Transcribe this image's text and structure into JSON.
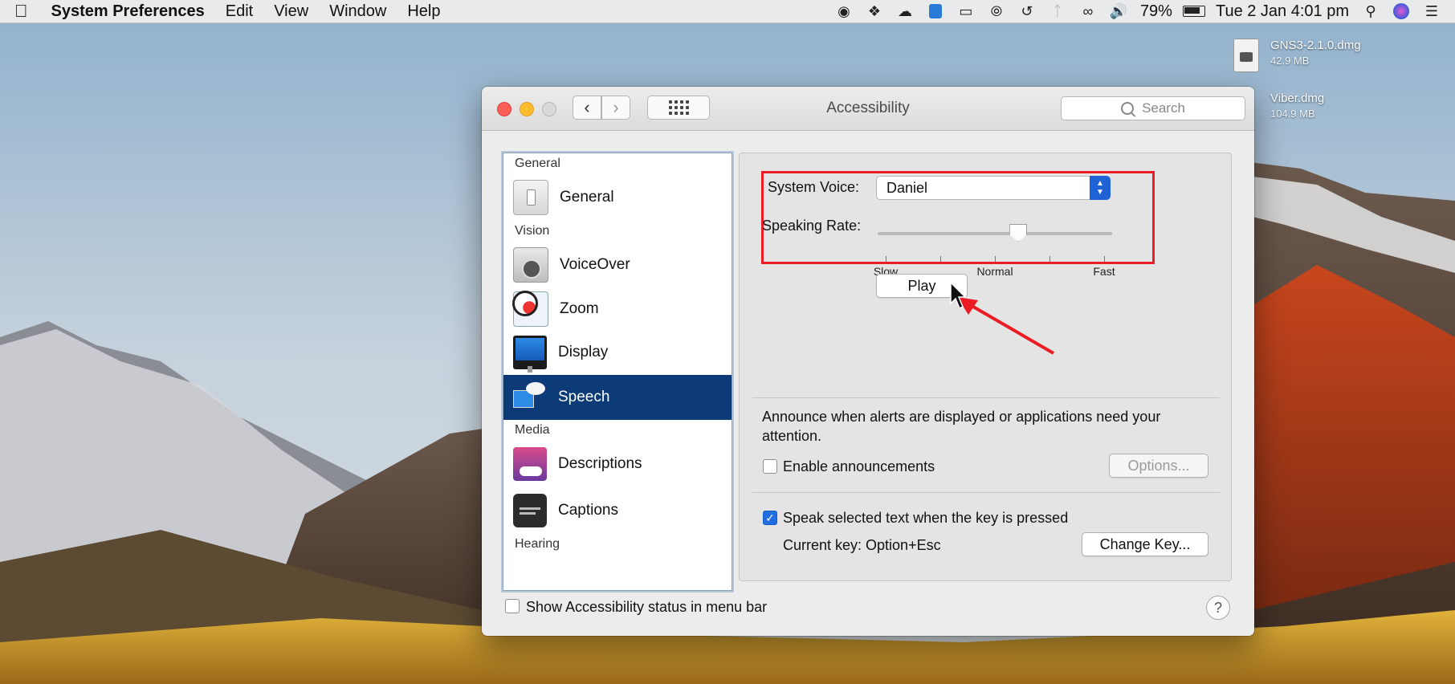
{
  "menubar": {
    "app_name": "System Preferences",
    "menus": [
      "Edit",
      "View",
      "Window",
      "Help"
    ],
    "battery": "79%",
    "clock": "Tue 2 Jan  4:01 pm",
    "status_icons": [
      "record-icon",
      "dropbox-icon",
      "cloud-upload-icon",
      "teamviewer-icon",
      "airplay-icon",
      "wifi-signal-icon",
      "time-machine-icon",
      "bluetooth-icon",
      "sync-icon",
      "volume-icon",
      "battery-icon",
      "spotlight-icon",
      "siri-icon",
      "notification-center-icon"
    ]
  },
  "desktop": {
    "files": [
      {
        "name": "GNS3-2.1.0.dmg",
        "size": "42.9 MB"
      },
      {
        "name": "Viber.dmg",
        "size": "104.9 MB"
      }
    ]
  },
  "window": {
    "title": "Accessibility",
    "search_placeholder": "Search"
  },
  "sidebar": {
    "sections": [
      {
        "header": "General",
        "items": [
          {
            "label": "General",
            "icon": "switch-icon"
          }
        ]
      },
      {
        "header": "Vision",
        "items": [
          {
            "label": "VoiceOver",
            "icon": "voiceover-icon"
          },
          {
            "label": "Zoom",
            "icon": "zoom-icon"
          },
          {
            "label": "Display",
            "icon": "display-icon"
          },
          {
            "label": "Speech",
            "icon": "speech-icon",
            "selected": true
          }
        ]
      },
      {
        "header": "Media",
        "items": [
          {
            "label": "Descriptions",
            "icon": "descriptions-icon"
          },
          {
            "label": "Captions",
            "icon": "captions-icon"
          }
        ]
      },
      {
        "header": "Hearing",
        "items": []
      }
    ]
  },
  "speech": {
    "system_voice_label": "System Voice:",
    "system_voice_value": "Daniel",
    "speaking_rate_label": "Speaking Rate:",
    "speaking_rate_level": 0.6,
    "rate_ticks": [
      "Slow",
      "",
      "Normal",
      "",
      "Fast"
    ],
    "play_label": "Play",
    "announce_text": "Announce when alerts are displayed or applications need your attention.",
    "enable_announcements_label": "Enable announcements",
    "enable_announcements_checked": false,
    "options_label": "Options...",
    "speak_selected_label": "Speak selected text when the key is pressed",
    "speak_selected_checked": true,
    "current_key_label": "Current key: Option+Esc",
    "change_key_label": "Change Key..."
  },
  "footer": {
    "show_status_label": "Show Accessibility status in menu bar",
    "show_status_checked": false,
    "help_label": "?"
  },
  "colors": {
    "accent": "#1f6fe0",
    "selection": "#0c3b78",
    "annotation": "#ec1c24"
  }
}
